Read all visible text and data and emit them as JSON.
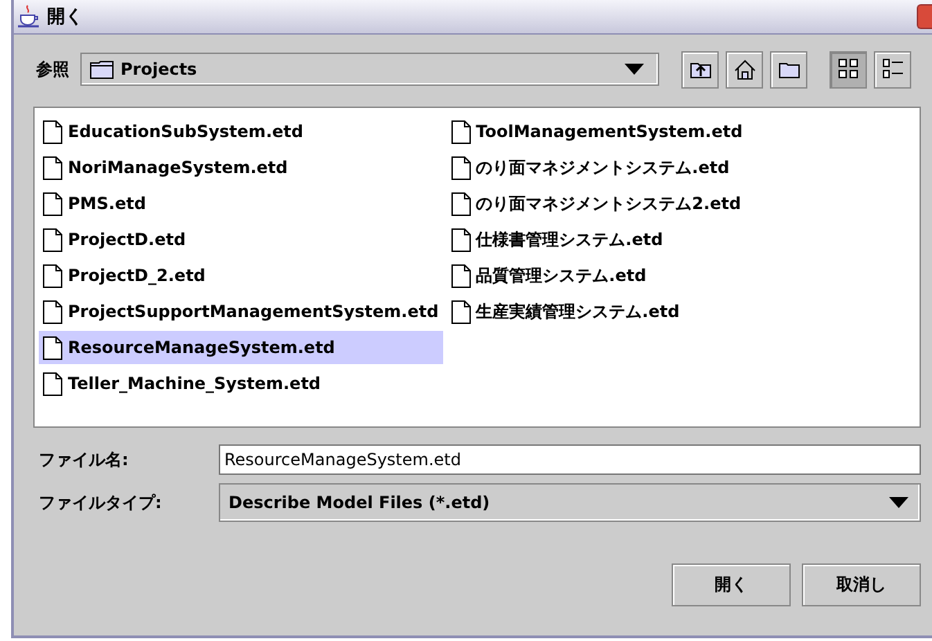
{
  "window": {
    "title": "開く"
  },
  "look_in": {
    "label": "参照",
    "value": "Projects"
  },
  "toolbar": [
    {
      "kind": "up"
    },
    {
      "kind": "home"
    },
    {
      "kind": "newfolder"
    },
    {
      "kind": "list",
      "selected": true
    },
    {
      "kind": "details",
      "selected": false
    }
  ],
  "files": [
    {
      "name": "EducationSubSystem.etd",
      "selected": false
    },
    {
      "name": "NoriManageSystem.etd",
      "selected": false
    },
    {
      "name": "PMS.etd",
      "selected": false
    },
    {
      "name": "ProjectD.etd",
      "selected": false
    },
    {
      "name": "ProjectD_2.etd",
      "selected": false
    },
    {
      "name": "ProjectSupportManagementSystem.etd",
      "selected": false
    },
    {
      "name": "ResourceManageSystem.etd",
      "selected": true
    },
    {
      "name": "Teller_Machine_System.etd",
      "selected": false
    },
    {
      "name": "ToolManagementSystem.etd",
      "selected": false
    },
    {
      "name": "のり面マネジメントシステム.etd",
      "selected": false
    },
    {
      "name": "のり面マネジメントシステム2.etd",
      "selected": false
    },
    {
      "name": "仕様書管理システム.etd",
      "selected": false
    },
    {
      "name": "品質管理システム.etd",
      "selected": false
    },
    {
      "name": "生産実績管理システム.etd",
      "selected": false
    }
  ],
  "file_name": {
    "label": "ファイル名:",
    "value": "ResourceManageSystem.etd"
  },
  "file_type": {
    "label": "ファイルタイプ:",
    "value": "Describe Model Files (*.etd)"
  },
  "buttons": [
    "開く",
    "取消し"
  ]
}
